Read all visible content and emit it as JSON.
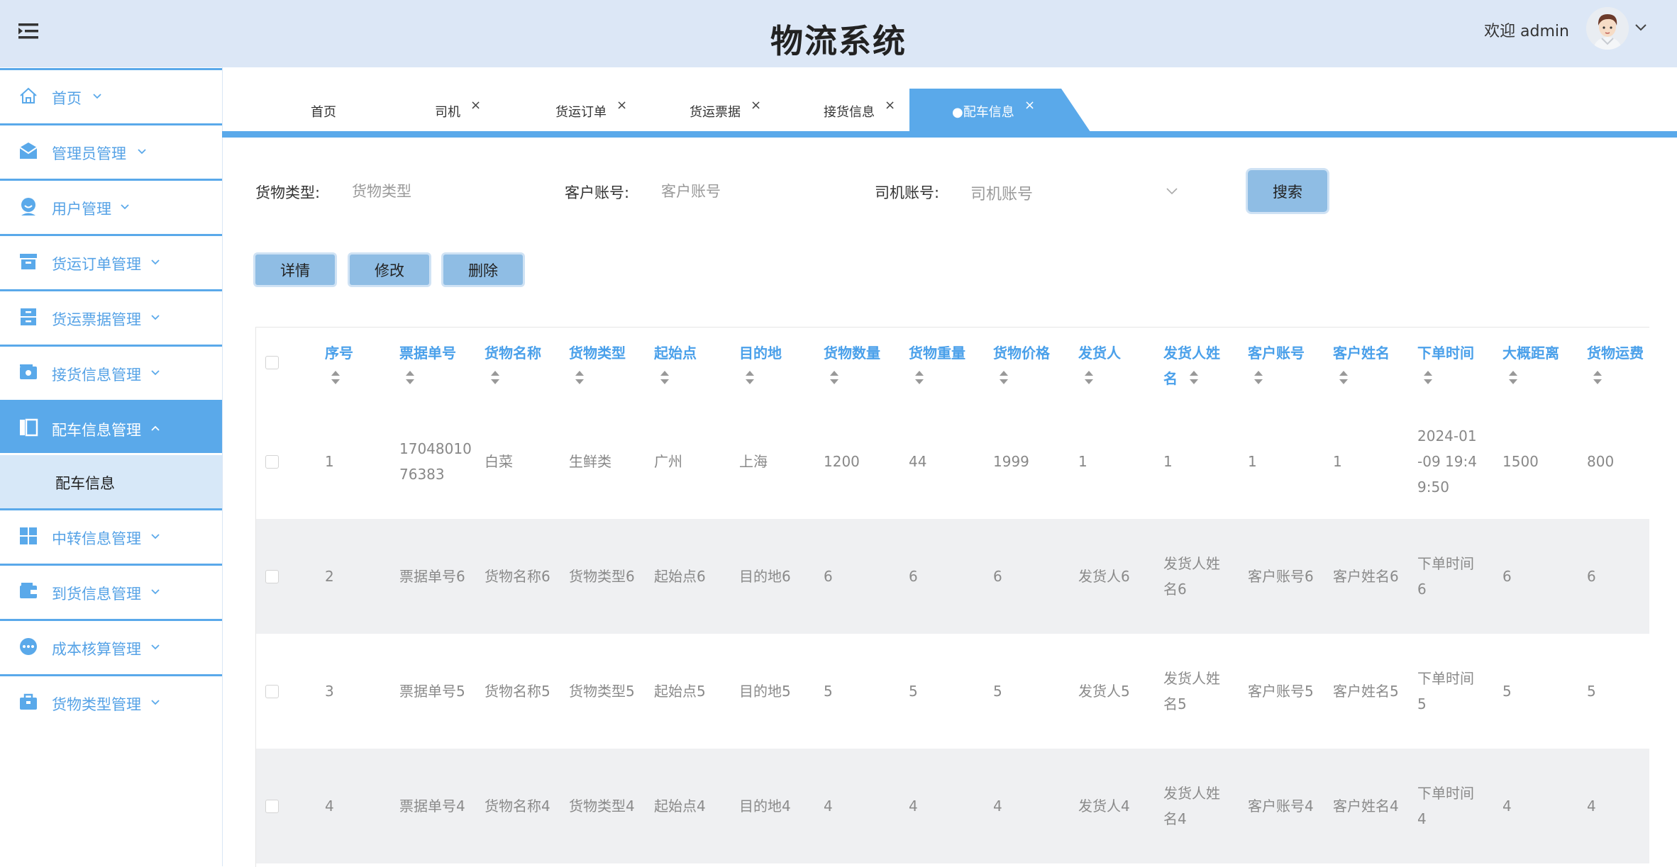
{
  "header": {
    "title": "物流系统",
    "welcome": "欢迎 admin"
  },
  "sidebar": {
    "items": [
      {
        "label": "首页",
        "icon": "home-icon"
      },
      {
        "label": "管理员管理",
        "icon": "envelope-icon"
      },
      {
        "label": "用户管理",
        "icon": "user-icon"
      },
      {
        "label": "货运订单管理",
        "icon": "archive-box-icon"
      },
      {
        "label": "货运票据管理",
        "icon": "cabinet-icon"
      },
      {
        "label": "接货信息管理",
        "icon": "wallet-card-icon"
      },
      {
        "label": "配车信息管理",
        "icon": "book-icon"
      },
      {
        "label": "中转信息管理",
        "icon": "grid-icon"
      },
      {
        "label": "到货信息管理",
        "icon": "wallet-icon"
      },
      {
        "label": "成本核算管理",
        "icon": "dots-circle-icon"
      },
      {
        "label": "货物类型管理",
        "icon": "briefcase-icon"
      }
    ],
    "sub_item": "配车信息"
  },
  "tabs": [
    {
      "label": "首页",
      "closable": false
    },
    {
      "label": "司机",
      "closable": true
    },
    {
      "label": "货运订单",
      "closable": true
    },
    {
      "label": "货运票据",
      "closable": true
    },
    {
      "label": "接货信息",
      "closable": true
    },
    {
      "label": "●配车信息",
      "closable": true,
      "active": true
    }
  ],
  "tab_close_glyph": "×",
  "search": {
    "cargo_type_label": "货物类型:",
    "cargo_type_placeholder": "货物类型",
    "customer_label": "客户账号:",
    "customer_placeholder": "客户账号",
    "driver_label": "司机账号:",
    "driver_placeholder": "司机账号",
    "search_button": "搜索"
  },
  "actions": {
    "detail": "详情",
    "edit": "修改",
    "delete": "删除"
  },
  "table": {
    "columns": [
      "序号",
      "票据单号",
      "货物名称",
      "货物类型",
      "起始点",
      "目的地",
      "货物数量",
      "货物重量",
      "货物价格",
      "发货人",
      "发货人姓名",
      "客户账号",
      "客户姓名",
      "下单时间",
      "大概距离",
      "货物运费"
    ],
    "rows": [
      [
        "1",
        "1704801076383",
        "白菜",
        "生鲜类",
        "广州",
        "上海",
        "1200",
        "44",
        "1999",
        "1",
        "1",
        "1",
        "1",
        "2024-01-09 19:49:50",
        "1500",
        "800"
      ],
      [
        "2",
        "票据单号6",
        "货物名称6",
        "货物类型6",
        "起始点6",
        "目的地6",
        "6",
        "6",
        "6",
        "发货人6",
        "发货人姓名6",
        "客户账号6",
        "客户姓名6",
        "下单时间6",
        "6",
        "6"
      ],
      [
        "3",
        "票据单号5",
        "货物名称5",
        "货物类型5",
        "起始点5",
        "目的地5",
        "5",
        "5",
        "5",
        "发货人5",
        "发货人姓名5",
        "客户账号5",
        "客户姓名5",
        "下单时间5",
        "5",
        "5"
      ],
      [
        "4",
        "票据单号4",
        "货物名称4",
        "货物类型4",
        "起始点4",
        "目的地4",
        "4",
        "4",
        "4",
        "发货人4",
        "发货人姓名4",
        "客户账号4",
        "客户姓名4",
        "下单时间4",
        "4",
        "4"
      ]
    ]
  },
  "colors": {
    "accent": "#5aa9ea",
    "header_bg": "#dce7f6",
    "column_header_text": "#4aa0ea",
    "button_bg": "#8fbde4",
    "shaded_row": "#eff0f2"
  }
}
